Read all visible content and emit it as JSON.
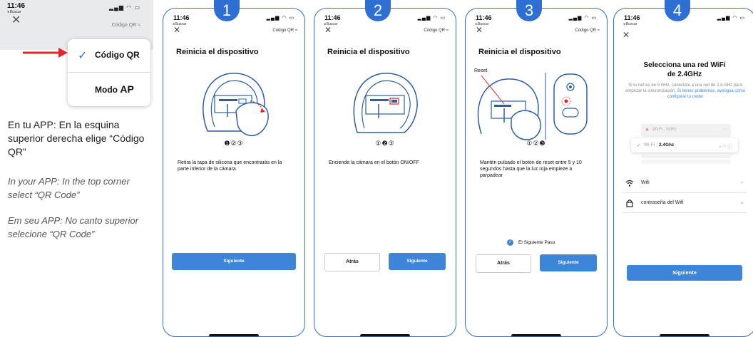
{
  "intro": {
    "status_time": "11:46",
    "back_label": "◂ Buscar",
    "qr_label": "Código QR ≈",
    "menu": {
      "item1": "Código QR",
      "item2_prefix": "Modo ",
      "item2_bold": "AP"
    },
    "text_es": "En tu APP: En la esquina superior derecha elige “Código QR”",
    "text_en": "In your APP: In the top corner select “QR Code”",
    "text_pt": "Em seu APP: No canto superior selecione “QR Code”"
  },
  "phones": [
    {
      "badge": "1",
      "time": "11:46",
      "back": "◂ Buscar",
      "qr": "Código QR ≈",
      "title": "Reinicia el dispositivo",
      "dots": "❶②③",
      "body": "Retira la tapa de silicona que encontrarás en la parte inferior de la cámara",
      "primary_btn": "Siguiente"
    },
    {
      "badge": "2",
      "time": "11:46",
      "back": "◂ Buscar",
      "qr": "Código QR ≈",
      "title": "Reinicia el dispositivo",
      "dots": "①❷③",
      "body": "Enciende la cámara en el botón ON/OFF",
      "secondary_btn": "Atrás",
      "primary_btn": "Siguiente"
    },
    {
      "badge": "3",
      "time": "11:46",
      "back": "◂ Buscar",
      "qr": "Código QR ≈",
      "title": "Reinicia el dispositivo",
      "reset_label": "Reset",
      "dots": "①②❸",
      "body": "Mantén pulsado el botón de reset entre 5 y 10 segundos hasta que la luz roja empieze a parpadear",
      "checkbox_label": "El Siguiente Paso",
      "secondary_btn": "Atrás",
      "primary_btn": "Siguiente"
    },
    {
      "badge": "4",
      "time": "11:46",
      "back": "◂ Buscar",
      "title_line1": "Selecciona una red WiFi",
      "title_line2": "de 2.4GHz",
      "note_plain": "Si tu red es de 5 GHz, conéctate a una red de 2,4 GHz para empezar la sincronización. ",
      "note_link": "Si tienes problemas, averigua cómo configurar tu router",
      "network_5g": "Wi-Fi - 5Ghz",
      "network_24_prefix": "Wi-Fi - ",
      "network_24_bold": "2.4Ghz",
      "wifi_field": "Wifi",
      "password_field": "contraseña del Wifi",
      "primary_btn": "Siguiente"
    }
  ],
  "colors": {
    "accent": "#2e6fd3",
    "button": "#3d85d8",
    "arrow": "#e0262b"
  }
}
